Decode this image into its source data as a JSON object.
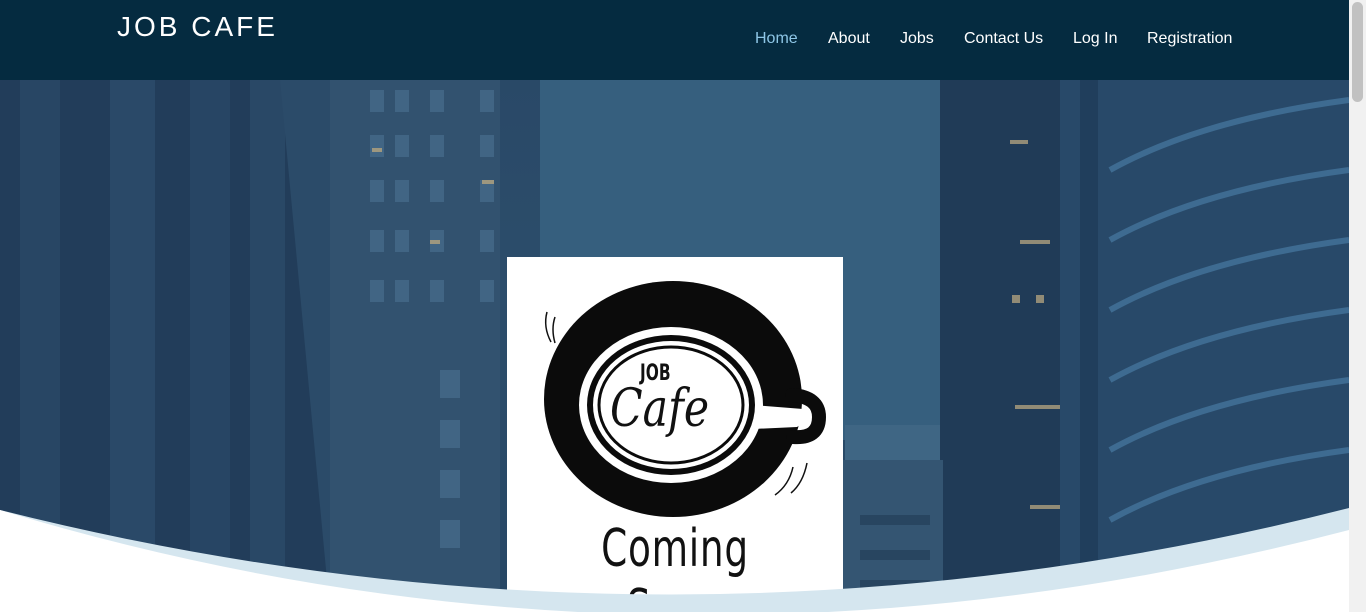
{
  "header": {
    "brand": "JOB CAFE",
    "nav": [
      {
        "label": "Home",
        "active": true
      },
      {
        "label": "About"
      },
      {
        "label": "Jobs"
      },
      {
        "label": "Contact Us"
      },
      {
        "label": "Log In"
      },
      {
        "label": "Registration"
      }
    ]
  },
  "hero": {
    "logo": {
      "job": "JOB",
      "cafe": "Cafe",
      "tagline": "Coming Soon"
    }
  },
  "colors": {
    "navbar": "#052b40",
    "nav_active": "#8ec6e6",
    "wave_light": "#d5e6ef"
  }
}
